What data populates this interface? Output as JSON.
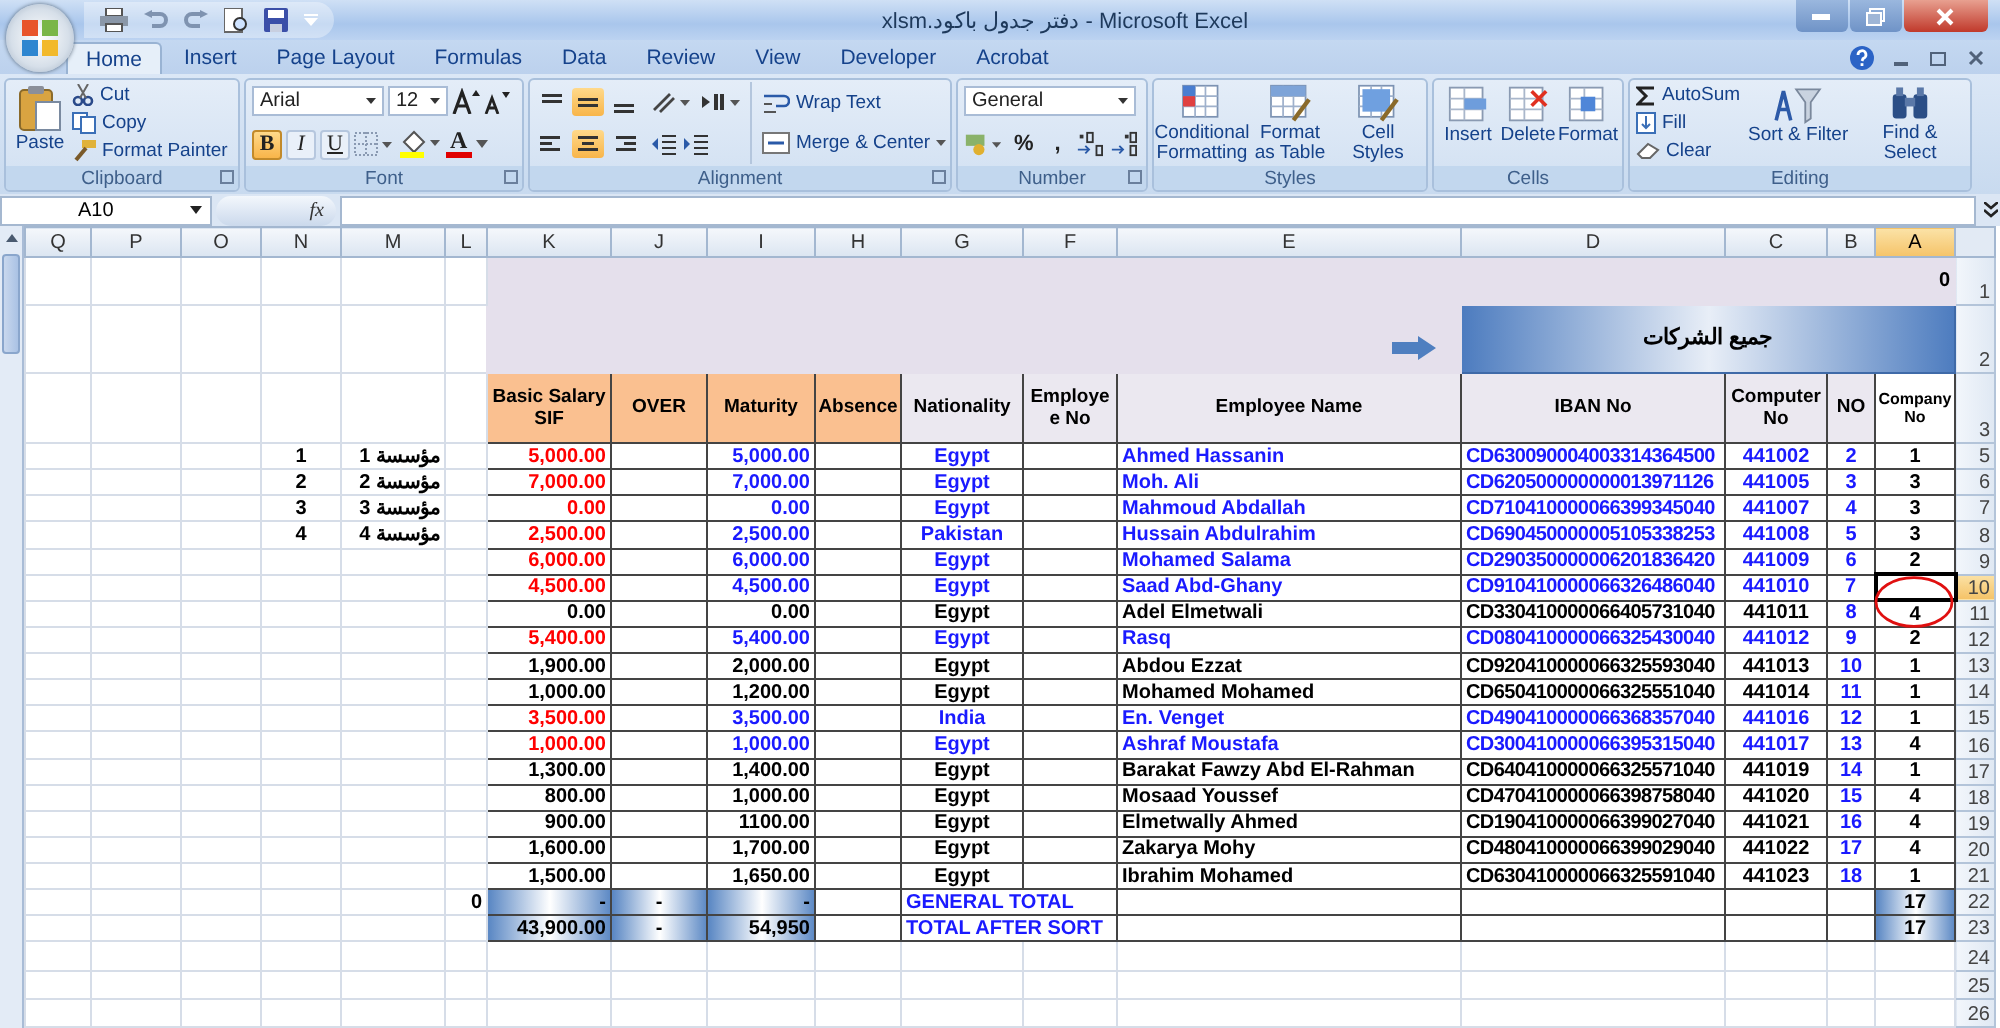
{
  "window": {
    "title_file": "دفتر جدول باكود.xlsm",
    "title_app": "- Microsoft Excel"
  },
  "tabs": [
    {
      "label": "Home",
      "selected": true
    },
    {
      "label": "Insert",
      "selected": false
    },
    {
      "label": "Page Layout",
      "selected": false
    },
    {
      "label": "Formulas",
      "selected": false
    },
    {
      "label": "Data",
      "selected": false
    },
    {
      "label": "Review",
      "selected": false
    },
    {
      "label": "View",
      "selected": false
    },
    {
      "label": "Developer",
      "selected": false
    },
    {
      "label": "Acrobat",
      "selected": false
    }
  ],
  "ribbon": {
    "clipboard": {
      "label": "Clipboard",
      "paste": "Paste",
      "items": [
        "Cut",
        "Copy",
        "Format Painter"
      ]
    },
    "font": {
      "label": "Font",
      "name": "Arial",
      "size": "12",
      "styles": [
        {
          "label": "B",
          "selected": true
        },
        {
          "label": "I",
          "selected": false
        },
        {
          "label": "U",
          "selected": false
        }
      ],
      "font_color": "A"
    },
    "alignment": {
      "label": "Alignment",
      "vertical": [
        {
          "selected": false
        },
        {
          "selected": true
        },
        {
          "selected": false
        }
      ],
      "horizontal": [
        {
          "selected": false
        },
        {
          "selected": true
        },
        {
          "selected": false
        }
      ],
      "wrap_text": "Wrap Text",
      "merge": "Merge & Center"
    },
    "number": {
      "label": "Number",
      "format": "General",
      "percent": "%",
      "comma": ","
    },
    "styles": {
      "label": "Styles",
      "buttons": [
        "Conditional Formatting",
        "Format as Table",
        "Cell Styles"
      ]
    },
    "cells": {
      "label": "Cells",
      "buttons": [
        "Insert",
        "Delete",
        "Format"
      ]
    },
    "editing": {
      "label": "Editing",
      "items": [
        "AutoSum",
        "Fill",
        "Clear"
      ],
      "buttons": [
        "Sort & Filter",
        "Find & Select"
      ]
    }
  },
  "formula_bar": {
    "name_box": "A10",
    "function_label": "fx"
  },
  "sheet": {
    "columns": [
      {
        "letter": "Q",
        "selected": false
      },
      {
        "letter": "P",
        "selected": false
      },
      {
        "letter": "O",
        "selected": false
      },
      {
        "letter": "N",
        "selected": false
      },
      {
        "letter": "M",
        "selected": false
      },
      {
        "letter": "L",
        "selected": false
      },
      {
        "letter": "K",
        "selected": false
      },
      {
        "letter": "J",
        "selected": false
      },
      {
        "letter": "I",
        "selected": false
      },
      {
        "letter": "H",
        "selected": false
      },
      {
        "letter": "G",
        "selected": false
      },
      {
        "letter": "F",
        "selected": false
      },
      {
        "letter": "E",
        "selected": false
      },
      {
        "letter": "D",
        "selected": false
      },
      {
        "letter": "C",
        "selected": false
      },
      {
        "letter": "B",
        "selected": false
      },
      {
        "letter": "A",
        "selected": true
      }
    ],
    "row1": {
      "row_number": "1",
      "value": "0"
    },
    "row2": {
      "row_number": "2",
      "banner": "جميع الشركات"
    },
    "header_row": {
      "row_number": "3",
      "headers": [
        {
          "text": "Basic Salary SIF",
          "kind": "pay"
        },
        {
          "text": "OVER",
          "kind": "pay"
        },
        {
          "text": "Maturity",
          "kind": "pay"
        },
        {
          "text": "Absence",
          "kind": "pay"
        },
        {
          "text": "Nationality",
          "kind": "info"
        },
        {
          "text": "Employe e No",
          "kind": "info"
        },
        {
          "text": "Employee Name",
          "kind": "info"
        },
        {
          "text": "IBAN No",
          "kind": "info"
        },
        {
          "text": "Computer No",
          "kind": "info"
        },
        {
          "text": "NO",
          "kind": "info"
        },
        {
          "text": "Company No",
          "kind": "small"
        }
      ]
    },
    "employees": [
      {
        "row_number": "5",
        "side_no": "1",
        "side_label": "مؤسسة 1",
        "basic_salary": "5,000.00",
        "maturity": "5,000.00",
        "nationality": "Egypt",
        "name": "Ahmed Hassanin",
        "iban": "CD630090004003314364500",
        "computer_no": "441002",
        "no": "2",
        "company_no": "1",
        "highlighted": true,
        "selected": false
      },
      {
        "row_number": "6",
        "side_no": "2",
        "side_label": "مؤسسة 2",
        "basic_salary": "7,000.00",
        "maturity": "7,000.00",
        "nationality": "Egypt",
        "name": "Moh. Ali",
        "iban": "CD620500000000013971126",
        "computer_no": "441005",
        "no": "3",
        "company_no": "3",
        "highlighted": true,
        "selected": false
      },
      {
        "row_number": "7",
        "side_no": "3",
        "side_label": "مؤسسة 3",
        "basic_salary": "0.00",
        "maturity": "0.00",
        "nationality": "Egypt",
        "name": "Mahmoud Abdallah",
        "iban": "CD710410000066399345040",
        "computer_no": "441007",
        "no": "4",
        "company_no": "3",
        "highlighted": true,
        "selected": false
      },
      {
        "row_number": "8",
        "side_no": "4",
        "side_label": "مؤسسة 4",
        "basic_salary": "2,500.00",
        "maturity": "2,500.00",
        "nationality": "Pakistan",
        "name": "Hussain Abdulrahim",
        "iban": "CD690450000005105338253",
        "computer_no": "441008",
        "no": "5",
        "company_no": "3",
        "highlighted": true,
        "selected": false
      },
      {
        "row_number": "9",
        "basic_salary": "6,000.00",
        "maturity": "6,000.00",
        "nationality": "Egypt",
        "name": "Mohamed Salama",
        "iban": "CD290350000006201836420",
        "computer_no": "441009",
        "no": "6",
        "company_no": "2",
        "highlighted": true,
        "selected": false
      },
      {
        "row_number": "10",
        "basic_salary": "4,500.00",
        "maturity": "4,500.00",
        "nationality": "Egypt",
        "name": "Saad Abd-Ghany",
        "iban": "CD910410000066326486040",
        "computer_no": "441010",
        "no": "7",
        "highlighted": true,
        "selected": true
      },
      {
        "row_number": "11",
        "basic_salary": "0.00",
        "maturity": "0.00",
        "nationality": "Egypt",
        "name": "Adel Elmetwali",
        "iban": "CD330410000066405731040",
        "computer_no": "441011",
        "no": "8",
        "company_no": "4",
        "highlighted": false,
        "selected": false
      },
      {
        "row_number": "12",
        "basic_salary": "5,400.00",
        "maturity": "5,400.00",
        "nationality": "Egypt",
        "name": "Rasq",
        "iban": "CD080410000066325430040",
        "computer_no": "441012",
        "no": "9",
        "company_no": "2",
        "highlighted": true,
        "selected": false
      },
      {
        "row_number": "13",
        "basic_salary": "1,900.00",
        "maturity": "2,000.00",
        "nationality": "Egypt",
        "name": "Abdou Ezzat",
        "iban": "CD920410000066325593040",
        "computer_no": "441013",
        "no": "10",
        "company_no": "1",
        "highlighted": false,
        "selected": false
      },
      {
        "row_number": "14",
        "basic_salary": "1,000.00",
        "maturity": "1,200.00",
        "nationality": "Egypt",
        "name": "Mohamed Mohamed",
        "iban": "CD650410000066325551040",
        "computer_no": "441014",
        "no": "11",
        "company_no": "1",
        "highlighted": false,
        "selected": false
      },
      {
        "row_number": "15",
        "basic_salary": "3,500.00",
        "maturity": "3,500.00",
        "nationality": "India",
        "name": "En. Venget",
        "iban": "CD490410000066368357040",
        "computer_no": "441016",
        "no": "12",
        "company_no": "1",
        "highlighted": true,
        "selected": false
      },
      {
        "row_number": "16",
        "basic_salary": "1,000.00",
        "maturity": "1,000.00",
        "nationality": "Egypt",
        "name": "Ashraf Moustafa",
        "iban": "CD300410000066395315040",
        "computer_no": "441017",
        "no": "13",
        "company_no": "4",
        "highlighted": true,
        "selected": false
      },
      {
        "row_number": "17",
        "basic_salary": "1,300.00",
        "maturity": "1,400.00",
        "nationality": "Egypt",
        "name": "Barakat Fawzy Abd El-Rahman",
        "iban": "CD640410000066325571040",
        "computer_no": "441019",
        "no": "14",
        "company_no": "1",
        "highlighted": false,
        "selected": false
      },
      {
        "row_number": "18",
        "basic_salary": "800.00",
        "maturity": "1,000.00",
        "nationality": "Egypt",
        "name": "Mosaad Youssef",
        "iban": "CD470410000066398758040",
        "computer_no": "441020",
        "no": "15",
        "company_no": "4",
        "highlighted": false,
        "selected": false
      },
      {
        "row_number": "19",
        "basic_salary": "900.00",
        "maturity": "1100.00",
        "nationality": "Egypt",
        "name": "Elmetwally Ahmed",
        "iban": "CD190410000066399027040",
        "computer_no": "441021",
        "no": "16",
        "company_no": "4",
        "highlighted": false,
        "selected": false
      },
      {
        "row_number": "20",
        "basic_salary": "1,600.00",
        "maturity": "1,700.00",
        "nationality": "Egypt",
        "name": "Zakarya Mohy",
        "iban": "CD480410000066399029040",
        "computer_no": "441022",
        "no": "17",
        "company_no": "4",
        "highlighted": false,
        "selected": false
      },
      {
        "row_number": "21",
        "basic_salary": "1,500.00",
        "maturity": "1,650.00",
        "nationality": "Egypt",
        "name": "Ibrahim Mohamed",
        "iban": "CD630410000066325591040",
        "computer_no": "441023",
        "no": "18",
        "company_no": "1",
        "highlighted": false,
        "selected": false
      }
    ],
    "totals": [
      {
        "row_number": "22",
        "column_l": "0",
        "basic_salary": "-",
        "over": "-",
        "maturity": "-",
        "label": "GENERAL TOTAL",
        "company_no": "17"
      },
      {
        "row_number": "23",
        "basic_salary": "43,900.00",
        "over": "-",
        "maturity": "54,950",
        "label": "TOTAL AFTER SORT",
        "company_no": "17"
      }
    ],
    "empty_rows": [
      "24",
      "25",
      "26"
    ]
  }
}
